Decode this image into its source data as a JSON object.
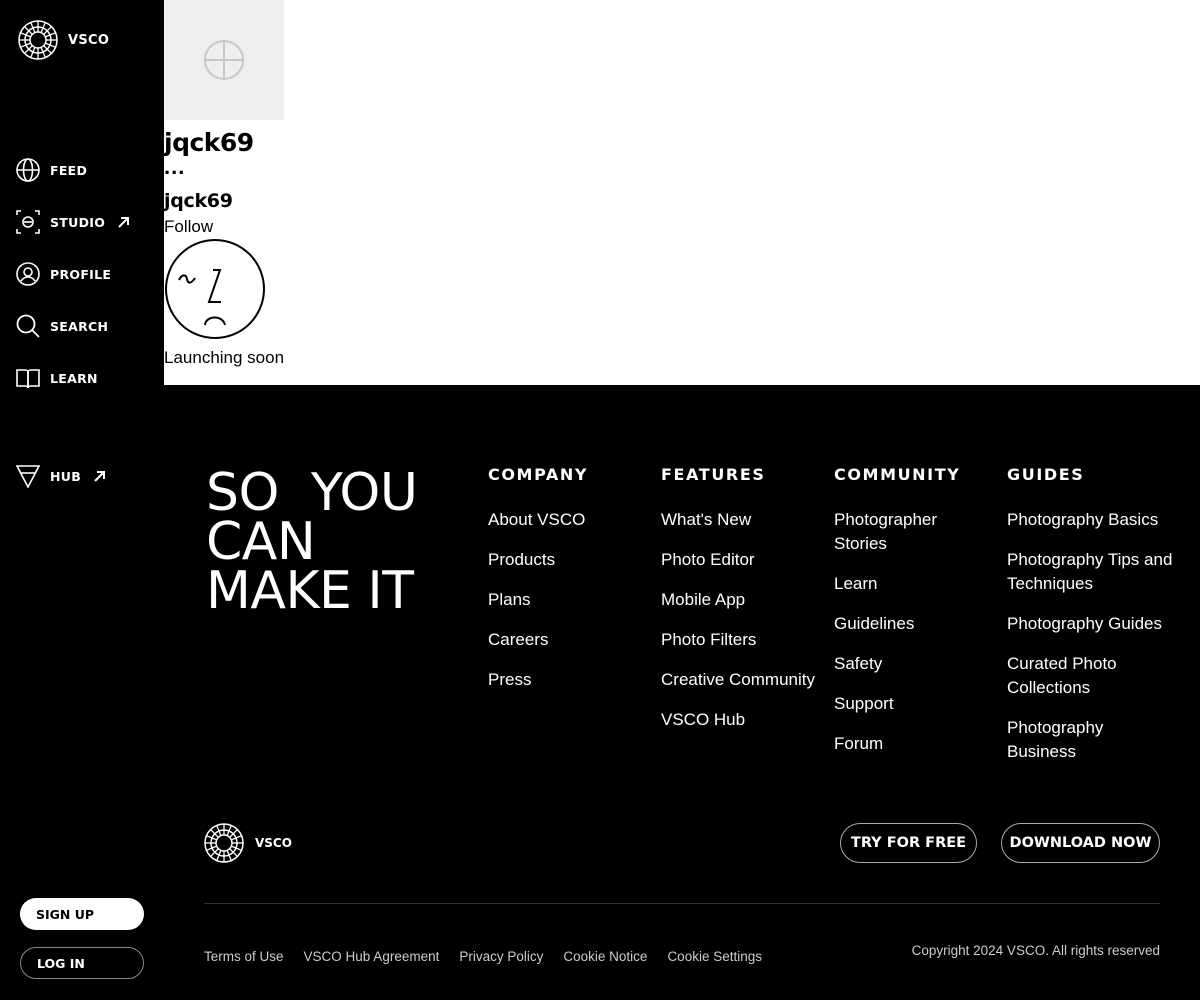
{
  "sidebar": {
    "brand": "VSCO",
    "nav": [
      {
        "label": "FEED",
        "icon": "globe-icon"
      },
      {
        "label": "STUDIO",
        "icon": "studio-icon",
        "external": true
      },
      {
        "label": "PROFILE",
        "icon": "user-icon"
      },
      {
        "label": "SEARCH",
        "icon": "search-icon"
      },
      {
        "label": "LEARN",
        "icon": "book-icon"
      },
      {
        "label": "HUB",
        "icon": "hub-icon",
        "external": true
      }
    ],
    "signup": "SIGN UP",
    "login": "LOG IN"
  },
  "profile": {
    "name": "jqck69",
    "dots": "...",
    "username": "jqck69",
    "follow": "Follow",
    "status": "Launching soon"
  },
  "footer": {
    "slogan": [
      "SO  YOU",
      "CAN",
      "MAKE IT"
    ],
    "columns": [
      {
        "title": "COMPANY",
        "links": [
          "About VSCO",
          "Products",
          "Plans",
          "Careers",
          "Press"
        ]
      },
      {
        "title": "FEATURES",
        "links": [
          "What's New",
          "Photo Editor",
          "Mobile App",
          "Photo Filters",
          "Creative Community",
          "VSCO Hub"
        ]
      },
      {
        "title": "COMMUNITY",
        "links": [
          "Photographer Stories",
          "Learn",
          "Guidelines",
          "Safety",
          "Support",
          "Forum"
        ]
      },
      {
        "title": "GUIDES",
        "links": [
          "Photography Basics",
          "Photography Tips and Techniques",
          "Photography Guides",
          "Curated Photo Collections",
          "Photography Business"
        ]
      }
    ],
    "brand": "VSCO",
    "try_free": "TRY FOR FREE",
    "download": "DOWNLOAD NOW",
    "legal": [
      "Terms of Use",
      "VSCO Hub Agreement",
      "Privacy Policy",
      "Cookie Notice",
      "Cookie Settings"
    ],
    "copyright": "Copyright 2024 VSCO. All rights reserved"
  },
  "colors": {
    "background": "#000000",
    "text": "#ffffff",
    "avatar_bg": "#eeeeee"
  }
}
